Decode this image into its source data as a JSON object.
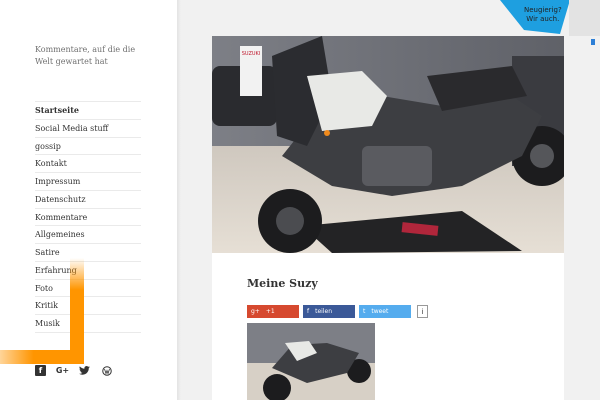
{
  "site": {
    "description": "Kommentare, auf die die Welt gewartet hat"
  },
  "menu": {
    "items": [
      {
        "label": "Startseite"
      },
      {
        "label": "Social Media stuff"
      },
      {
        "label": "gossip"
      },
      {
        "label": "Kontakt"
      },
      {
        "label": "Impressum"
      },
      {
        "label": "Datenschutz"
      },
      {
        "label": "Kommentare"
      },
      {
        "label": "Allgemeines"
      },
      {
        "label": "Satire"
      },
      {
        "label": "Erfahrung"
      },
      {
        "label": "Foto"
      },
      {
        "label": "Kritik"
      },
      {
        "label": "Musik"
      }
    ]
  },
  "social": {
    "icons": [
      "facebook-icon",
      "google-plus-icon",
      "twitter-icon",
      "wordpress-icon"
    ],
    "facebook_glyph": "f",
    "google_glyph": "G+",
    "twitter_glyph": "t",
    "wordpress_glyph": "W"
  },
  "post": {
    "title": "Meine Suzy",
    "hero_badge": "SUZUKI",
    "share": {
      "google_label": "+1",
      "google_glyph": "g+",
      "facebook_label": "teilen",
      "facebook_glyph": "f",
      "twitter_label": "tweet",
      "twitter_glyph": "t",
      "info_label": "i"
    }
  },
  "corner_badge": {
    "line1": "Neugierig?",
    "line2": "Wir auch."
  },
  "colors": {
    "accent": "#ff9500",
    "google": "#d6492f",
    "facebook": "#3b5998",
    "twitter": "#55acee",
    "badge": "#1e9fe0"
  }
}
